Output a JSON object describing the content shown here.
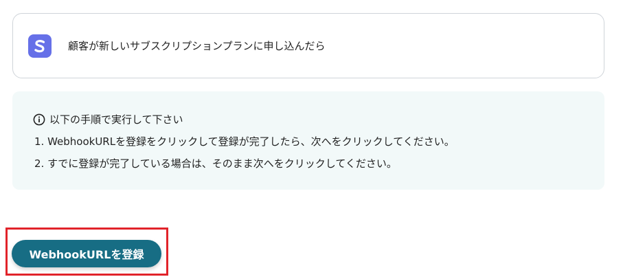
{
  "trigger": {
    "app_icon": "stripe-s-icon",
    "app_icon_color": "#6670e8",
    "description": "顧客が新しいサブスクリプションプランに申し込んだら"
  },
  "instructions": {
    "header_icon": "info-icon",
    "header": "以下の手順で実行して下さい",
    "steps": [
      "1. WebhookURLを登録をクリックして登録が完了したら、次へをクリックしてください。",
      "2. すでに登録が完了している場合は、そのまま次へをクリックしてください。"
    ],
    "background_color": "#f2f9f9"
  },
  "actions": {
    "register_label": "WebhookURLを登録",
    "button_color": "#176d84",
    "highlight_color": "#e1232a"
  }
}
